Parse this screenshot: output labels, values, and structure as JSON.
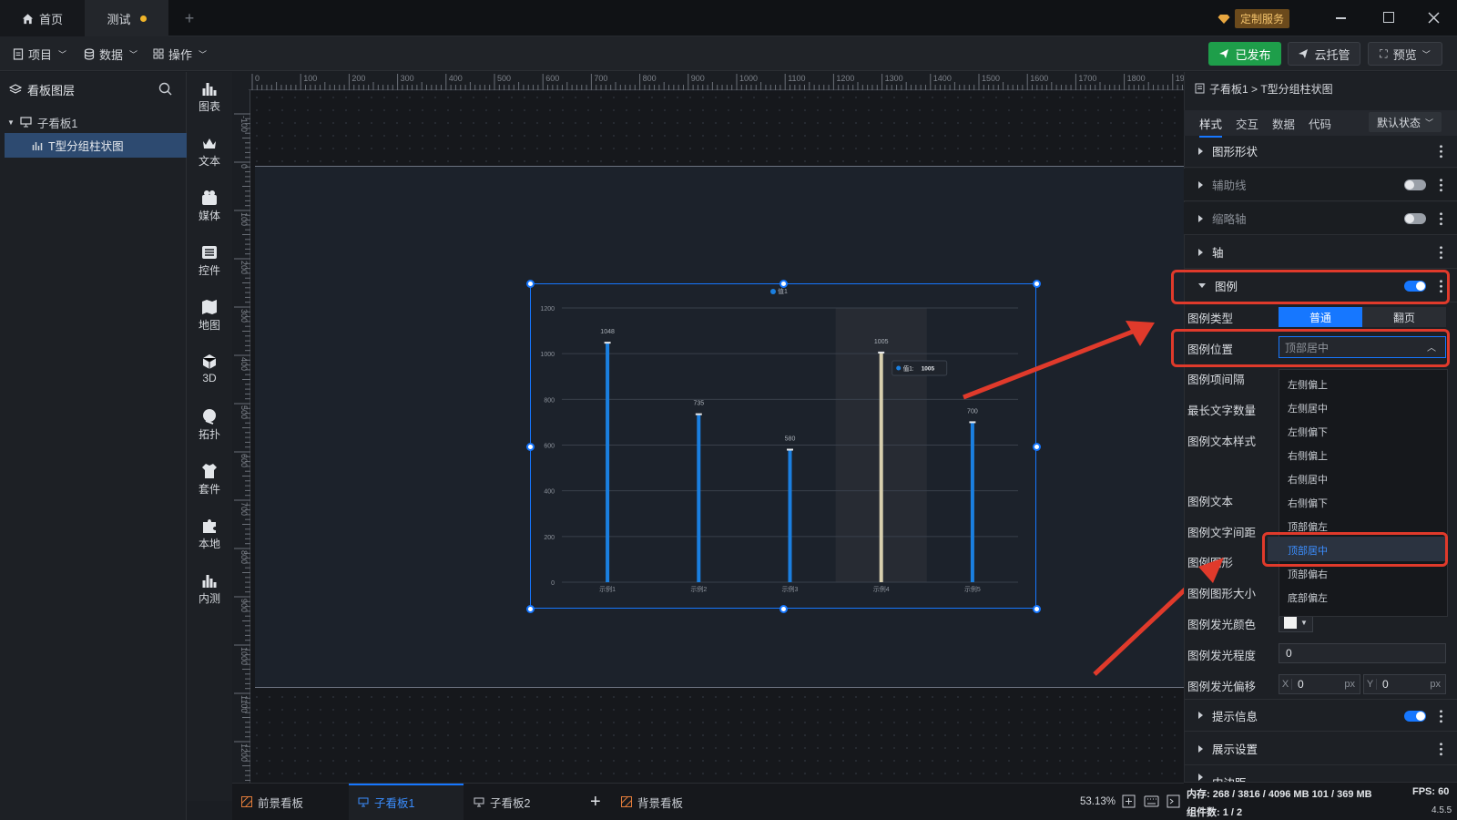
{
  "titlebar": {
    "tabs": [
      {
        "label": "首页",
        "icon": "home-icon"
      },
      {
        "label": "测试",
        "modified": true
      }
    ],
    "custom_service": "定制服务"
  },
  "menubar": {
    "menus": [
      {
        "label": "项目",
        "icon": "file-icon"
      },
      {
        "label": "数据",
        "icon": "database-icon"
      },
      {
        "label": "操作",
        "icon": "grid-icon"
      }
    ],
    "published": "已发布",
    "cloud": "云托管",
    "preview": "预览"
  },
  "layers": {
    "title": "看板图层",
    "tree": [
      {
        "label": "子看板1",
        "icon": "board-icon"
      },
      {
        "label": "T型分组柱状图",
        "icon": "bar-chart-icon",
        "selected": true
      }
    ]
  },
  "components": [
    "图表",
    "文本",
    "媒体",
    "控件",
    "地图",
    "3D",
    "拓扑",
    "套件",
    "本地",
    "内测"
  ],
  "ruler": {
    "top": [
      "0",
      "100",
      "200",
      "300",
      "400",
      "500",
      "600",
      "700",
      "800",
      "900",
      "1000",
      "1100",
      "1200",
      "1300",
      "1400",
      "1500",
      "1600",
      "1700",
      "1800",
      "1900"
    ],
    "left": [
      "-100",
      "0",
      "100",
      "200",
      "300",
      "400",
      "500",
      "600",
      "700",
      "800",
      "900",
      "1000",
      "1100",
      "1200"
    ]
  },
  "chart_data": {
    "type": "bar",
    "categories": [
      "示例1",
      "示例2",
      "示例3",
      "示例4",
      "示例5"
    ],
    "series": [
      {
        "name": "值1",
        "values": [
          1048,
          735,
          580,
          1005,
          700
        ]
      }
    ],
    "ylim": [
      0,
      1200
    ],
    "yticks": [
      "0",
      "200",
      "400",
      "600",
      "800",
      "1000",
      "1200"
    ],
    "legend_label": "值1",
    "legend_position": "top-center",
    "tooltip": {
      "label": "值1:",
      "value": "1005"
    },
    "highlight_index": 3,
    "colors": {
      "bar": "#1a7fe0",
      "highlight": "#d8cfae"
    }
  },
  "right_panel": {
    "breadcrumb": "子看板1 > T型分组柱状图",
    "tabs": [
      "样式",
      "交互",
      "数据",
      "代码"
    ],
    "state": "默认状态",
    "sections_top": [
      {
        "label": "图形形状",
        "toggle": false,
        "dim": false
      },
      {
        "label": "辅助线",
        "toggle": "off",
        "dim": true
      },
      {
        "label": "缩略轴",
        "toggle": "off",
        "dim": true
      },
      {
        "label": "轴",
        "toggle": false,
        "dim": false
      }
    ],
    "legend_section": "图例",
    "legend_type_label": "图例类型",
    "legend_type_options": [
      "普通",
      "翻页"
    ],
    "legend_pos_label": "图例位置",
    "legend_pos_value": "顶部居中",
    "props": [
      "图例项间隔",
      "最长文字数量",
      "图例文本样式",
      "图例文本",
      "图例文字间距",
      "图例图形",
      "图例图形大小",
      "图例发光颜色",
      "图例发光程度",
      "图例发光偏移"
    ],
    "dropdown_options": [
      "左侧偏上",
      "左侧居中",
      "左侧偏下",
      "右侧偏上",
      "右侧居中",
      "右侧偏下",
      "顶部偏左",
      "顶部居中",
      "顶部偏右",
      "底部偏左"
    ],
    "dropdown_selected": "顶部居中",
    "glow_level": "0",
    "offset_x": "0",
    "offset_y": "0",
    "axis_x": "X",
    "axis_y": "Y",
    "unit": "px",
    "sections_bottom": [
      "提示信息",
      "展示设置",
      "内边距"
    ]
  },
  "bottom": {
    "tabs": [
      "前景看板",
      "子看板1",
      "子看板2",
      "背景看板"
    ],
    "add": "+",
    "zoom": "53.13%",
    "memory": "内存: 268 / 3816 / 4096 MB  101 / 369 MB",
    "fps": "FPS: 60",
    "components": "组件数: 1 / 2",
    "version": "4.5.5"
  },
  "colors": {
    "accent": "#1677ff",
    "published": "#1e9e4a",
    "annotation": "#e03a2b",
    "custom_service_bg": "#6b4a1c"
  }
}
